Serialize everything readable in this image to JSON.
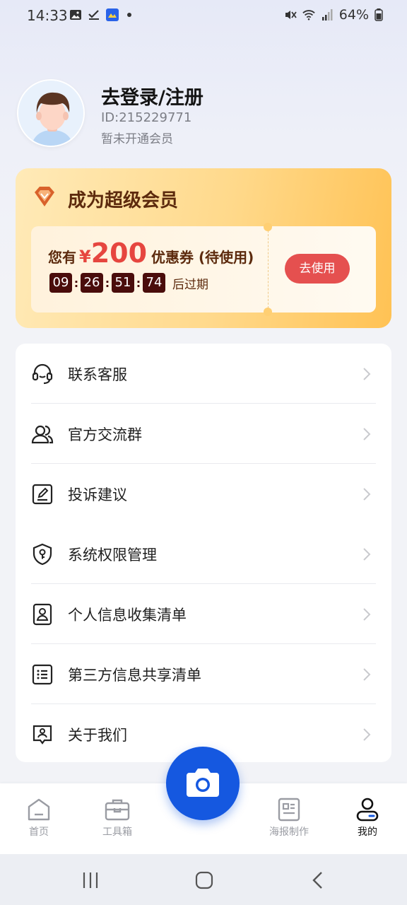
{
  "status_bar": {
    "time": "14:33",
    "battery": "64%"
  },
  "profile": {
    "name": "去登录/注册",
    "id": "ID:215229771",
    "vip_status": "暂未开通会员"
  },
  "vip": {
    "title": "成为超级会员",
    "coupon_prefix": "您有",
    "currency": "¥",
    "amount": "200",
    "coupon_suffix": "优惠券 (待使用)",
    "timer": [
      "09",
      "26",
      "51",
      "74"
    ],
    "expire_text": "后过期",
    "use_button": "去使用"
  },
  "menu": {
    "items": [
      {
        "label": "联系客服",
        "icon": "headset-icon"
      },
      {
        "label": "官方交流群",
        "icon": "group-icon"
      },
      {
        "label": "投诉建议",
        "icon": "edit-note-icon"
      },
      {
        "label": "系统权限管理",
        "icon": "shield-key-icon"
      },
      {
        "label": "个人信息收集清单",
        "icon": "id-card-icon"
      },
      {
        "label": "第三方信息共享清单",
        "icon": "list-icon"
      },
      {
        "label": "关于我们",
        "icon": "about-icon"
      }
    ]
  },
  "bottom_nav": {
    "tabs": [
      {
        "label": "首页",
        "icon": "home-icon"
      },
      {
        "label": "工具箱",
        "icon": "toolbox-icon"
      },
      {
        "label": "海报制作",
        "icon": "poster-icon"
      },
      {
        "label": "我的",
        "icon": "profile-icon"
      }
    ],
    "active": "我的"
  },
  "colors": {
    "accent_blue": "#1558e0",
    "coupon_red": "#e5504f",
    "vip_brown": "#5c2a0d"
  }
}
